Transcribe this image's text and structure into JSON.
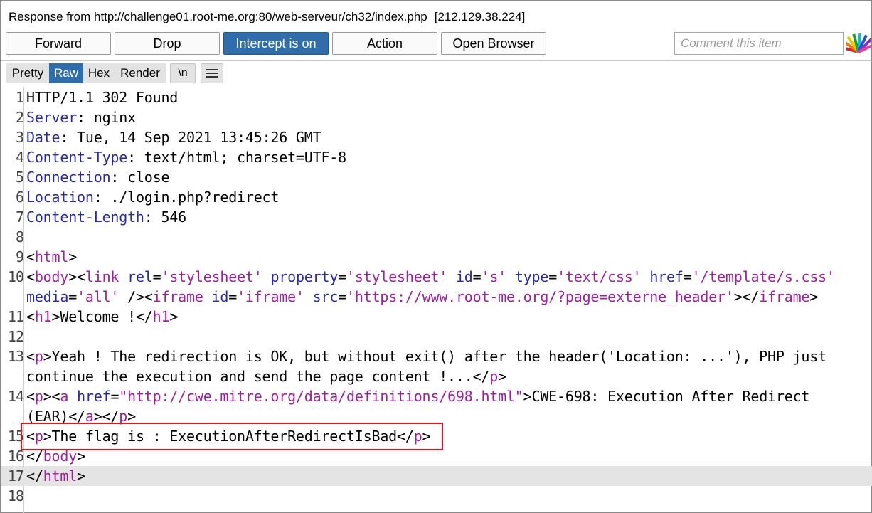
{
  "header": {
    "response_label": "Response from http://challenge01.root-me.org:80/web-serveur/ch32/index.php",
    "ip": "[212.129.38.224]"
  },
  "toolbar": {
    "forward": "Forward",
    "drop": "Drop",
    "intercept": "Intercept is on",
    "action": "Action",
    "open_browser": "Open Browser",
    "comment_placeholder": "Comment this item",
    "active_color": "#2f6eab"
  },
  "tabs": {
    "pretty": "Pretty",
    "raw": "Raw",
    "hex": "Hex",
    "render": "Render",
    "newline": "\\n",
    "active": "Raw"
  },
  "editor": {
    "line_numbers": [
      "1",
      "2",
      "3",
      "4",
      "5",
      "6",
      "7",
      "8",
      "9",
      "10",
      "11",
      "12",
      "13",
      "14",
      "15",
      "16",
      "17",
      "18"
    ],
    "status_line": "HTTP/1.1 302 Found",
    "headers": [
      {
        "key": "Server",
        "value": "nginx"
      },
      {
        "key": "Date",
        "value": "Tue, 14 Sep 2021 13:45:26 GMT"
      },
      {
        "key": "Content-Type",
        "value": "text/html; charset=UTF-8"
      },
      {
        "key": "Connection",
        "value": "close"
      },
      {
        "key": "Location",
        "value": "./login.php?redirect"
      },
      {
        "key": "Content-Length",
        "value": "546"
      }
    ],
    "body": {
      "l10_link_href": "'/template/s.css'",
      "l10_iframe_src": "'https://www.root-me.org/?page=externe_header'",
      "h1_text": "Welcome !",
      "p1_text_a": "Yeah ! The redirection is OK, but without exit() after the header('Location: ...'), PHP just",
      "p1_text_b": "continue the execution and send the page content !...",
      "p2_href": "\"http://cwe.mitre.org/data/definitions/698.html\"",
      "p2_text_a": "CWE-698: Execution After Redirect",
      "p2_text_b": "(EAR)",
      "flag_text": "The flag is : ExecutionAfterRedirectIsBad"
    },
    "highlight_color": "#e0141a"
  }
}
